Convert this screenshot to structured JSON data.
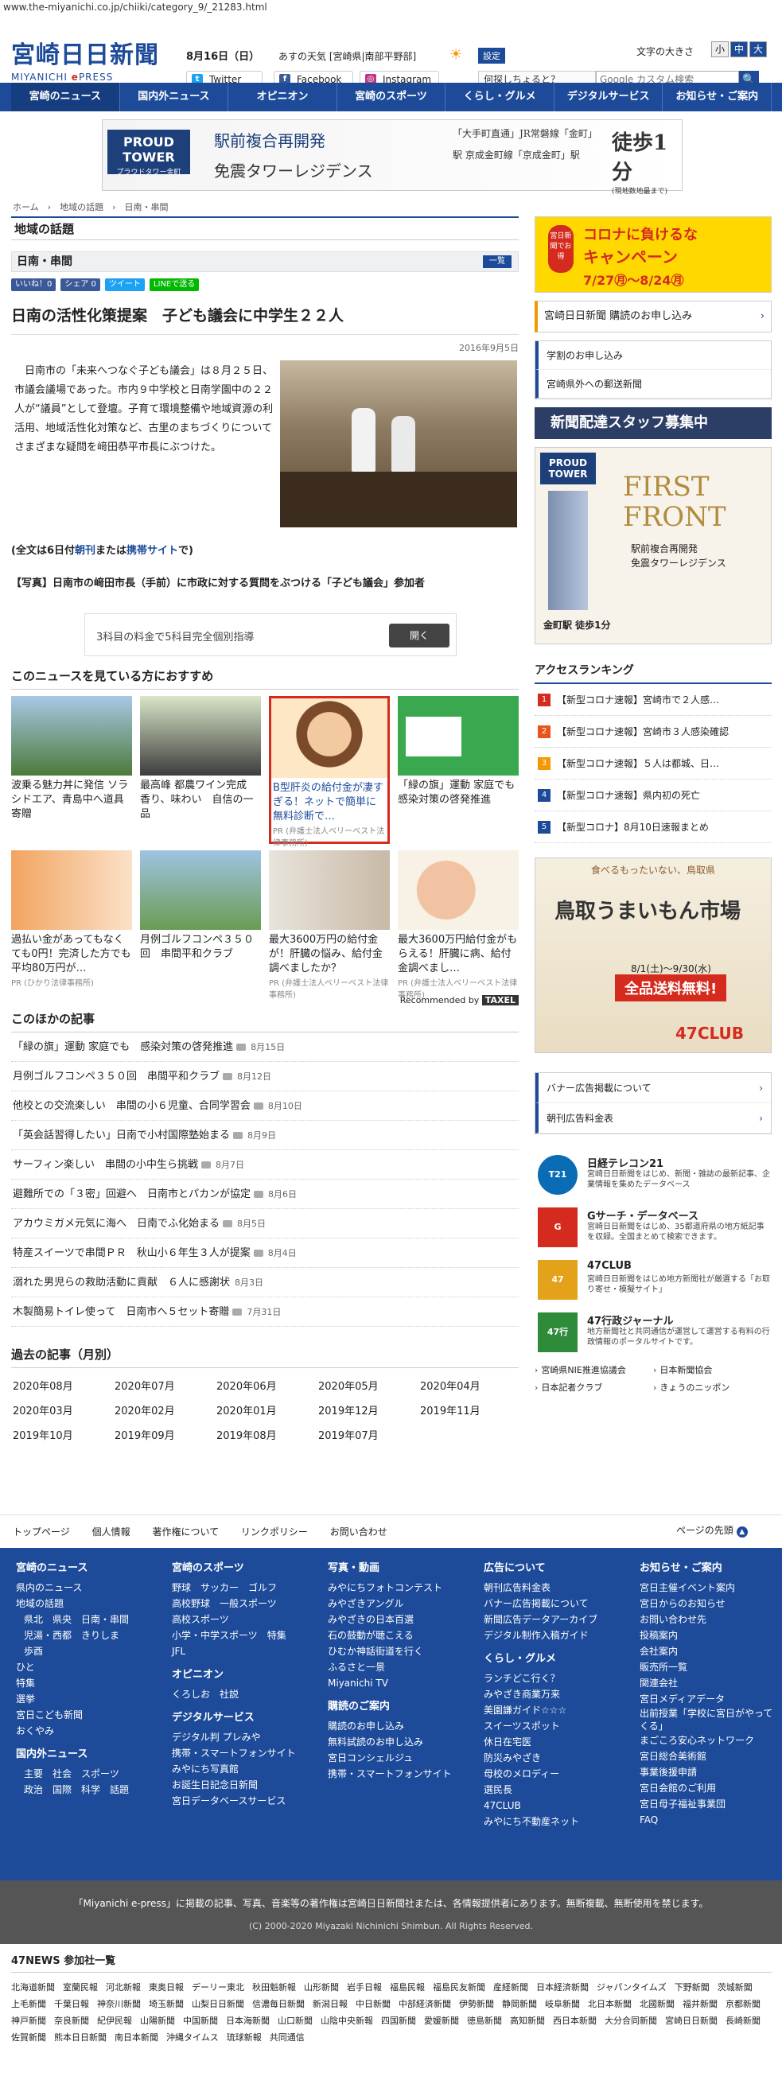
{
  "url": "www.the-miyanichi.co.jp/chiiki/category_9/_21283.html",
  "header": {
    "logo": "宮崎日日新聞",
    "logo_sub_a": "MIYANICHI",
    "logo_sub_b": "e",
    "logo_sub_c": "PRESS",
    "date": "8月16日（日）",
    "weather": "あすの天気 [宮崎県|南部平野部]",
    "setting": "設定",
    "font_size_label": "文字の大きさ",
    "font_small": "小",
    "font_mid": "中",
    "font_large": "大",
    "twitter": "Twitter",
    "facebook": "Facebook",
    "instagram": "Instagram",
    "search_query": "何探しちょると？",
    "search_placeholder": "Google カスタム検索"
  },
  "nav": [
    "宮崎のニュース",
    "国内外ニュース",
    "オピニオン",
    "宮崎のスポーツ",
    "くらし・グルメ",
    "デジタルサービス",
    "お知らせ・ご案内"
  ],
  "top_banner": {
    "logo": "PROUD TOWER",
    "logo_sub": "プラウドタワー金町",
    "line1": "駅前複合再開発",
    "line2": "免震タワーレジデンス",
    "station": "「大手町直通」JR常磐線「金町」駅 京成金町線「京成金町」駅",
    "walk": "徒歩1分",
    "walk_note": "(現地数地最まで)"
  },
  "breadcrumb": "ホーム　›　地域の話題　›　日南・串間",
  "section": "地域の話題",
  "subsection": "日南・串間",
  "list_button": "一覧",
  "share": [
    "いいね！0",
    "シェア 0",
    "ツイート",
    "LINEで送る"
  ],
  "article": {
    "title": "日南の活性化策提案　子ども議会に中学生２２人",
    "date": "2016年9月5日",
    "body": "日南市の「未来へつなぐ子ども議会」は８月２５日、市議会議場であった。市内９中学校と日南学園中の２２人が“議員”として登壇。子育て環境整備や地域資源の利活用、地域活性化対策など、古里のまちづくりについてさまざまな疑問を﨑田恭平市長にぶつけた。",
    "fulltext_a": "(全文は6日付",
    "fulltext_b": "朝刊",
    "fulltext_c": "または",
    "fulltext_d": "携帯サイト",
    "fulltext_e": "で)",
    "caption": "【写真】日南市の﨑田市長（手前）に市政に対する質問をぶつける「子ども議会」参加者"
  },
  "ad_small": {
    "text": "3科目の料金で5科目完全個別指導",
    "button": "開く"
  },
  "recommend": {
    "heading": "このニュースを見ている方におすすめ",
    "items": [
      {
        "title": "波乗る魅力丼に発信 ソラシドエア、青島中へ道具寄贈",
        "pr": ""
      },
      {
        "title": "最高峰 都農ワイン完成　香り、味わい　自信の一品",
        "pr": ""
      },
      {
        "title": "B型肝炎の給付金が凄すぎる！ネットで簡単に無料診断で…",
        "pr": "PR (弁護士法人ベリーベスト法律事務所)"
      },
      {
        "title": "「緑の旗」運動 家庭でも　感染対策の啓発推進",
        "pr": ""
      },
      {
        "title": "過払い金があってもなくても0円！完済した方でも平均80万円が…",
        "pr": "PR (ひかり法律事務所)"
      },
      {
        "title": "月例ゴルフコンペ３５０回　串間平和クラブ",
        "pr": ""
      },
      {
        "title": "最大3600万円の給付金が！肝臓の悩み、給付金調べましたか？",
        "pr": "PR (弁護士法人ベリーベスト法律事務所)"
      },
      {
        "title": "最大3600万円給付金がもらえる！肝臓に病、給付金調べまし…",
        "pr": "PR (弁護士法人ベリーベスト法律事務所)"
      }
    ],
    "recommended_by": "Recommended by",
    "taxel": "TAXEL"
  },
  "other": {
    "heading": "このほかの記事",
    "items": [
      {
        "title": "「緑の旗」運動 家庭でも　感染対策の啓発推進",
        "date": "8月15日"
      },
      {
        "title": "月例ゴルフコンペ３５０回　串間平和クラブ",
        "date": "8月12日"
      },
      {
        "title": "他校との交流楽しい　串間の小６児童、合同学習会",
        "date": "8月10日"
      },
      {
        "title": "「英会話習得したい」日南で小村国際塾始まる",
        "date": "8月9日"
      },
      {
        "title": "サーフィン楽しい　串間の小中生ら挑戦",
        "date": "8月7日"
      },
      {
        "title": "避難所での「３密」回避へ　日南市とパカンが協定",
        "date": "8月6日"
      },
      {
        "title": "アカウミガメ元気に海へ　日南でふ化始まる",
        "date": "8月5日"
      },
      {
        "title": "特産スイーツで串間ＰＲ　秋山小６年生３人が提案",
        "date": "8月4日"
      },
      {
        "title": "溺れた男児らの救助活動に貢献　６人に感謝状",
        "date": "8月3日"
      },
      {
        "title": "木製簡易トイレ使って　日南市へ５セット寄贈",
        "date": "7月31日"
      }
    ]
  },
  "past": {
    "heading": "過去の記事（月別）",
    "months": [
      "2020年08月",
      "2020年07月",
      "2020年06月",
      "2020年05月",
      "2020年04月",
      "2020年03月",
      "2020年02月",
      "2020年01月",
      "2019年12月",
      "2019年11月",
      "2019年10月",
      "2019年09月",
      "2019年08月",
      "2019年07月"
    ]
  },
  "side": {
    "campaign_a": "コロナに負けるな",
    "campaign_b": "キャンペーン",
    "campaign_date": "7/27㊊〜8/24㊊",
    "campaign_tag": "宮日新聞でお得",
    "subscribe": "宮崎日日新聞 購読のお申し込み",
    "box": [
      "学割のお申し込み",
      "宮崎県外への郵送新聞"
    ],
    "staff": "新聞配達スタッフ募集中",
    "front_logo": "PROUD TOWER",
    "front_title_a": "FIRST",
    "front_title_b": "FRONT",
    "front_s1": "駅前複合再開発",
    "front_s2": "免震タワーレジデンス",
    "front_s3": "金町駅 徒歩1分",
    "rank_heading": "アクセスランキング",
    "rank": [
      "【新型コロナ速報】宮崎市で２人感…",
      "【新型コロナ速報】宮崎市３人感染確認",
      "【新型コロナ速報】５人は都城、日…",
      "【新型コロナ速報】県内初の死亡",
      "【新型コロナ】8月10日速報まとめ"
    ],
    "tottori_a": "食べるもったいない、鳥取県",
    "tottori_b": "鳥取うまいもん市場",
    "tottori_c": "8/1(土)〜9/30(水)",
    "tottori_d": "全品送料無料!",
    "tottori_e": "47CLUB",
    "adlinks": [
      "バナー広告掲載について",
      "朝刊広告料金表"
    ],
    "services": [
      {
        "name": "日経テレコン21",
        "desc": "宮崎日日新聞をはじめ、新聞・雑誌の最新記事、企業情報を集めたデータベース",
        "icon": "T21"
      },
      {
        "name": "Gサーチ・データベース",
        "desc": "宮崎日日新聞をはじめ、35都道府県の地方紙記事を収録。全国まとめて検索できます。",
        "icon": "G"
      },
      {
        "name": "47CLUB",
        "desc": "宮崎日日新聞をはじめ地方新聞社が厳選する「お取り寄せ・模擬サイト」",
        "icon": "47"
      },
      {
        "name": "47行政ジャーナル",
        "desc": "地方新聞社と共同通信が運営して運営する有料の行政情報のポータルサイトです。",
        "icon": "47行"
      }
    ],
    "mini": [
      "宮崎県NIE推進協議会",
      "日本新聞協会",
      "日本記者クラブ",
      "きょうのニッポン"
    ]
  },
  "footer_nav": [
    "トップページ",
    "個人情報",
    "著作権について",
    "リンクポリシー",
    "お問い合わせ"
  ],
  "page_top": "ページの先頭",
  "footer": {
    "col1": {
      "h": "宮崎のニュース",
      "items": [
        "県内のニュース",
        "地域の話題"
      ],
      "sub": [
        "県北　県央　日南・串間",
        "児湯・西都　きりしま",
        "歩酉"
      ],
      "items2": [
        "ひと",
        "特集",
        "選挙",
        "宮日こども新聞",
        "おくやみ"
      ],
      "h2": "国内外ニュース",
      "sub2": [
        "主要　社会　スポーツ",
        "政治　国際　科学　話題"
      ]
    },
    "col2": {
      "h": "宮崎のスポーツ",
      "items": [
        "野球　サッカー　ゴルフ",
        "高校野球　一般スポーツ",
        "高校スポーツ",
        "小学・中学スポーツ　特集",
        "JFL"
      ],
      "h2": "オピニオン",
      "items2": [
        "くろしお　社説"
      ],
      "h3": "デジタルサービス",
      "items3": [
        "デジタル判 プレみや",
        "携帯・スマートフォンサイト",
        "みやにち写真館",
        "お誕生日記念日新聞",
        "宮日データベースサービス"
      ]
    },
    "col3": {
      "h": "写真・動画",
      "items": [
        "みやにちフォトコンテスト",
        "みやざきアングル",
        "みやざきの日本百選",
        "石の鼓動が聴こえる",
        "ひむか神話街道を行く",
        "ふるさと一景",
        "Miyanichi TV"
      ],
      "h2": "購読のご案内",
      "items2": [
        "購読のお申し込み",
        "無料試読のお申し込み",
        "宮日コンシェルジュ",
        "携帯・スマートフォンサイト"
      ]
    },
    "col4": {
      "h": "広告について",
      "items": [
        "朝刊広告料金表",
        "バナー広告掲載について",
        "新聞広告データアーカイブ",
        "デジタル制作入稿ガイド"
      ],
      "h2": "くらし・グルメ",
      "items2": [
        "ランチどこ行く？",
        "みやざき商業万来",
        "美園謙ガイド☆☆☆",
        "スイーツスポット",
        "休日在宅医",
        "防災みやざき",
        "母校のメロディー",
        "選民長",
        "47CLUB",
        "みやにち不動産ネット"
      ]
    },
    "col5": {
      "h": "お知らせ・ご案内",
      "items": [
        "宮日主催イベント案内",
        "宮日からのお知らせ",
        "お問い合わせ先",
        "投稿案内",
        "会社案内",
        "販売所一覧",
        "関連会社",
        "宮日メディアデータ",
        "出前授業「学校に宮日がやってくる」",
        "まごころ安心ネットワーク",
        "宮日総合美術館",
        "事業後援申請",
        "宮日会館のご利用",
        "宮日母子福祉事業団",
        "FAQ"
      ]
    }
  },
  "copyright_a": "「Miyanichi e-press」に掲載の記事、写真、音楽等の著作権は宮崎日日新聞社または、各情報提供者にあります。無断複載、無断使用を禁じます。",
  "copyright_b": "(C) 2000-2020 Miyazaki Nichinichi Shimbun. All Rights Reserved.",
  "news47": {
    "heading": "47NEWS 参加社一覧",
    "items": [
      "北海道新聞",
      "室蘭民報",
      "河北新報",
      "東奥日報",
      "デーリー東北",
      "秋田魁新報",
      "山形新聞",
      "岩手日報",
      "福島民報",
      "福島民友新聞",
      "産経新聞",
      "日本経済新聞",
      "ジャパンタイムズ",
      "下野新聞",
      "茨城新聞",
      "上毛新聞",
      "千葉日報",
      "神奈川新聞",
      "埼玉新聞",
      "山梨日日新聞",
      "信濃毎日新聞",
      "新潟日報",
      "中日新聞",
      "中部経済新聞",
      "伊勢新聞",
      "静岡新聞",
      "岐阜新聞",
      "北日本新聞",
      "北國新聞",
      "福井新聞",
      "京都新聞",
      "神戸新聞",
      "奈良新聞",
      "紀伊民報",
      "山陽新聞",
      "中国新聞",
      "日本海新聞",
      "山口新聞",
      "山陰中央新報",
      "四国新聞",
      "愛媛新聞",
      "徳島新聞",
      "高知新聞",
      "西日本新聞",
      "大分合同新聞",
      "宮崎日日新聞",
      "長崎新聞",
      "佐賀新聞",
      "熊本日日新聞",
      "南日本新聞",
      "沖縄タイムス",
      "琉球新報",
      "共同通信"
    ]
  }
}
